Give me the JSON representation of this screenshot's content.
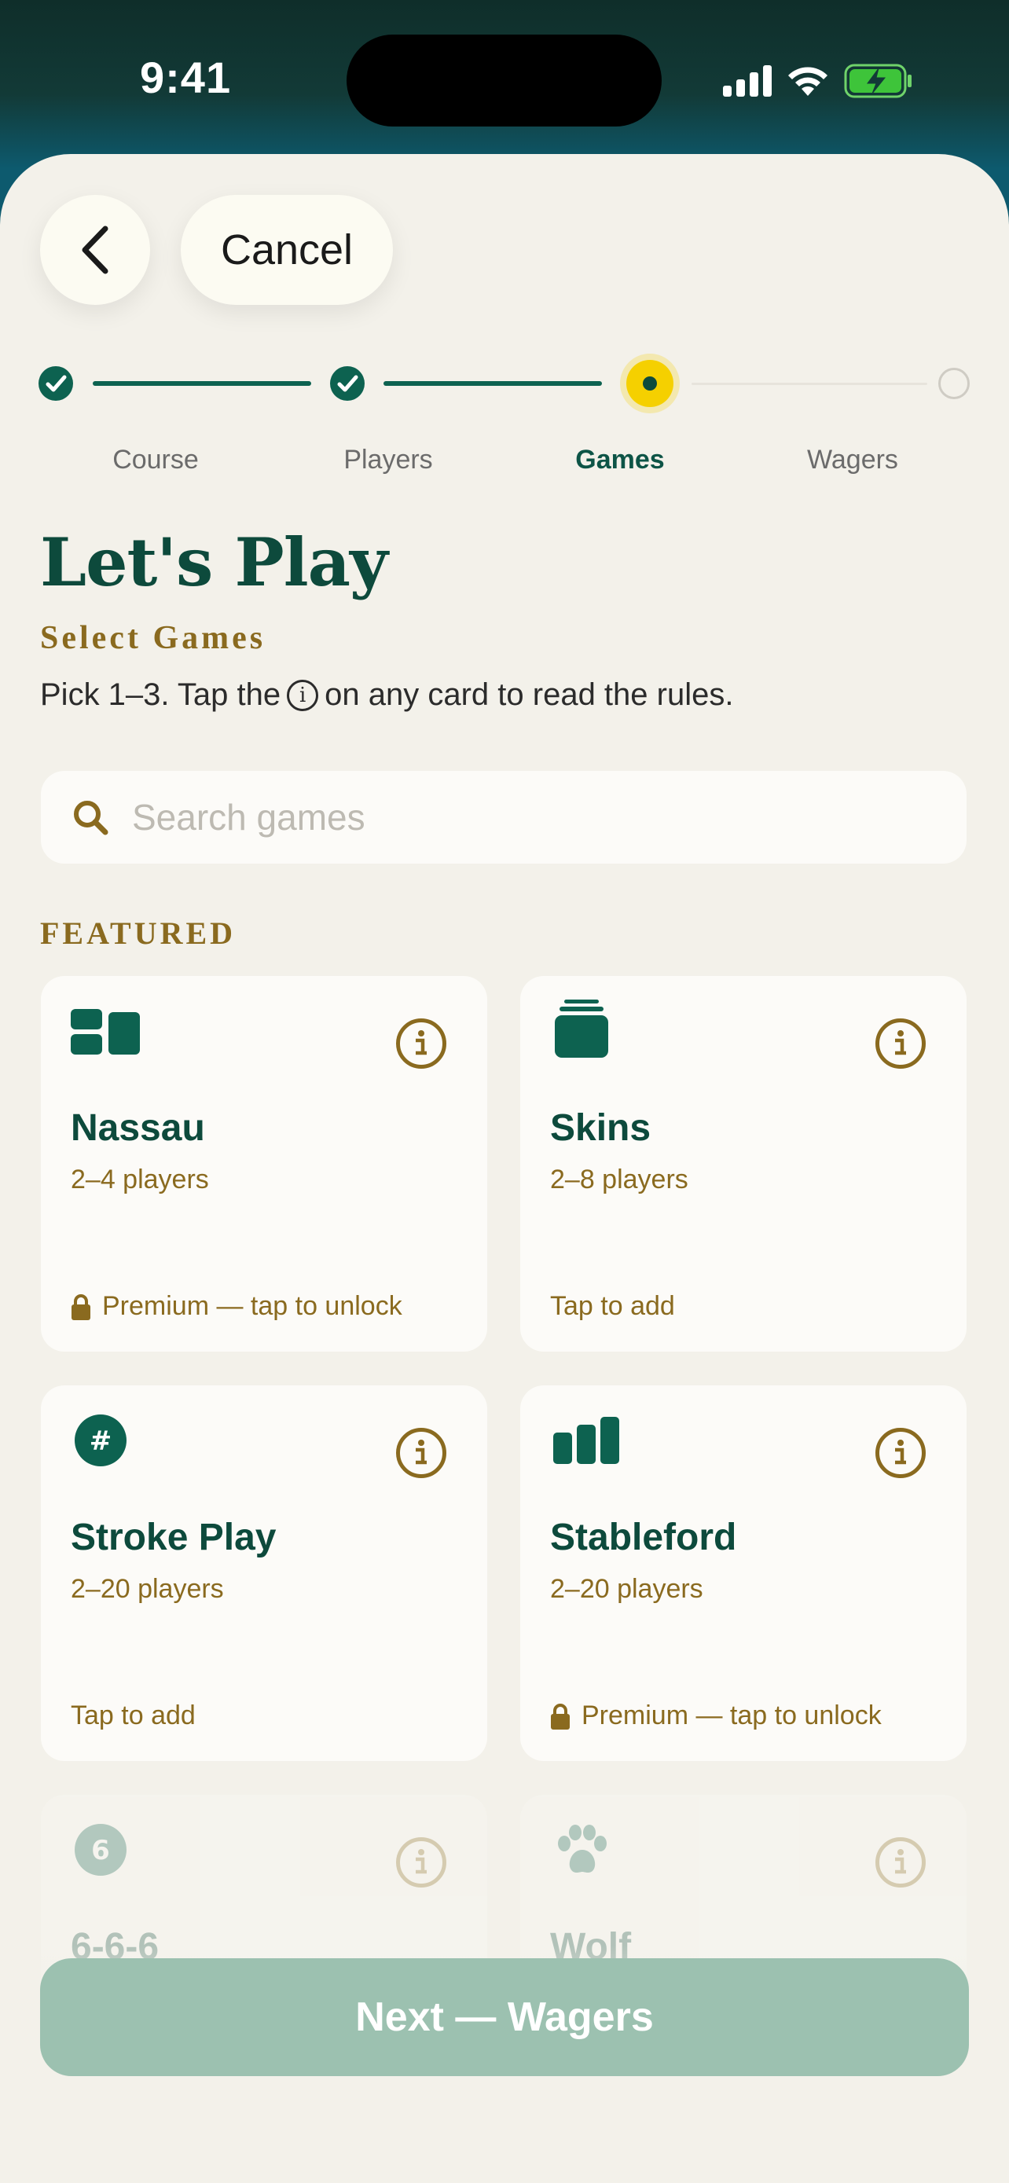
{
  "status_bar": {
    "time": "9:41"
  },
  "nav": {
    "cancel_label": "Cancel"
  },
  "stepper": {
    "steps": [
      {
        "label": "Course",
        "state": "complete"
      },
      {
        "label": "Players",
        "state": "complete"
      },
      {
        "label": "Games",
        "state": "current"
      },
      {
        "label": "Wagers",
        "state": "upcoming"
      }
    ]
  },
  "header": {
    "title": "Let's Play",
    "subtitle": "Select Games",
    "hint_before": "Pick 1–3. Tap the",
    "hint_glyph": "i",
    "hint_after": "on any card to read the rules."
  },
  "search": {
    "placeholder": "Search games"
  },
  "featured": {
    "label": "FEATURED",
    "games": [
      {
        "name": "Nassau",
        "players": "2–4 players",
        "footer": "Premium — tap to unlock",
        "locked": true,
        "icon": "split-tiles-icon"
      },
      {
        "name": "Skins",
        "players": "2–8 players",
        "footer": "Tap to add",
        "locked": false,
        "icon": "card-stack-icon"
      },
      {
        "name": "Stroke Play",
        "players": "2–20 players",
        "footer": "Tap to add",
        "locked": false,
        "icon": "hash-badge-icon",
        "badge": "#"
      },
      {
        "name": "Stableford",
        "players": "2–20 players",
        "footer": "Premium — tap to unlock",
        "locked": true,
        "icon": "bar-chart-icon"
      },
      {
        "name": "6-6-6",
        "players": "",
        "footer": "",
        "locked": false,
        "icon": "six-badge-icon",
        "badge": "6"
      },
      {
        "name": "Wolf",
        "players": "",
        "footer": "",
        "locked": false,
        "icon": "paw-icon"
      }
    ]
  },
  "cta": {
    "next_label": "Next — Wagers"
  },
  "colors": {
    "brand_green": "#0d4a3c",
    "accent_gold": "#8a6a1f",
    "current_step": "#f5d000",
    "disabled_button": "#9cc1b0"
  }
}
